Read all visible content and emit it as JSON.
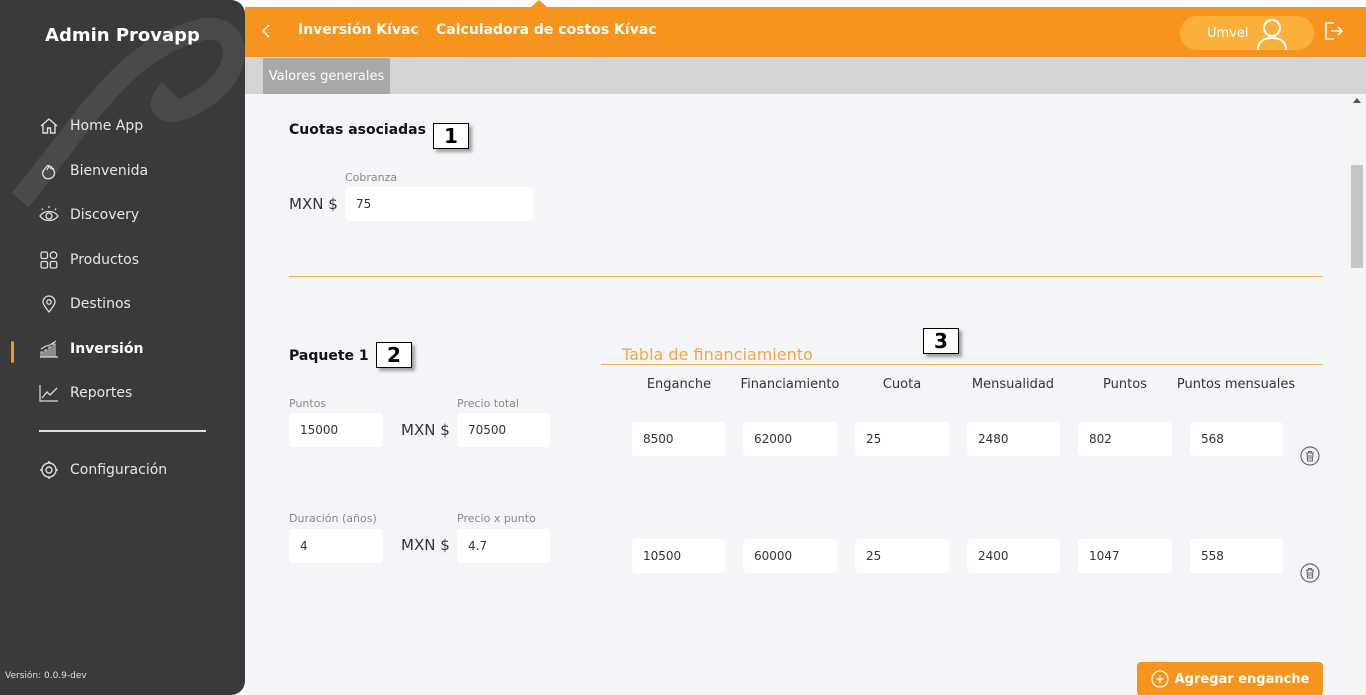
{
  "sidebar": {
    "app_title": "Admin Provapp",
    "items": [
      {
        "label": "Home App",
        "icon": "home-icon"
      },
      {
        "label": "Bienvenida",
        "icon": "wave-hand-icon"
      },
      {
        "label": "Discovery",
        "icon": "eye-icon"
      },
      {
        "label": "Productos",
        "icon": "grid-icon"
      },
      {
        "label": "Destinos",
        "icon": "map-pin-icon"
      },
      {
        "label": "Inversión",
        "icon": "bar-chart-icon",
        "active": true
      },
      {
        "label": "Reportes",
        "icon": "line-chart-icon"
      },
      {
        "label": "Configuración",
        "icon": "gear-icon"
      }
    ],
    "version": "Versión: 0.0.9-dev"
  },
  "header": {
    "breadcrumb_1": "Inversión Kívac",
    "breadcrumb_2": "Calculadora de costos Kívac",
    "user_name": "Umvel",
    "accent": "#f7941d"
  },
  "tabs": [
    {
      "label": "Valores generales",
      "active": true
    }
  ],
  "cuotas": {
    "title": "Cuotas asociadas",
    "marker": "1",
    "cobranza_label": "Cobranza",
    "currency": "MXN $",
    "cobranza_value": "75"
  },
  "paquete": {
    "title": "Paquete 1",
    "marker": "2",
    "puntos_label": "Puntos",
    "puntos_value": "15000",
    "precio_total_label": "Precio total",
    "precio_total_value": "70500",
    "duracion_label": "Duración (años)",
    "duracion_value": "4",
    "precio_punto_label": "Precio x punto",
    "precio_punto_value": "4.7",
    "currency": "MXN $"
  },
  "financiamiento": {
    "title": "Tabla de financiamiento",
    "marker": "3",
    "columns": [
      "Enganche",
      "Financiamiento",
      "Cuota",
      "Mensualidad",
      "Puntos",
      "Puntos mensuales"
    ],
    "rows": [
      [
        "8500",
        "62000",
        "25",
        "2480",
        "802",
        "568"
      ],
      [
        "10500",
        "60000",
        "25",
        "2400",
        "1047",
        "558"
      ]
    ],
    "add_button": "Agregar enganche"
  }
}
